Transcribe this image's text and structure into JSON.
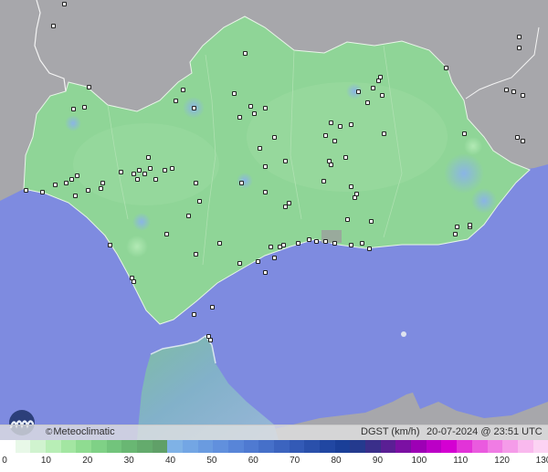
{
  "map": {
    "brand_symbol": "©",
    "brand_name": "Meteoclimatic",
    "parameter_label": "DGST (km/h)",
    "timestamp": "20-07-2024 @ 23:51 UTC",
    "colors": {
      "sea": "#7e8be0",
      "land_neighbor": "#a6a6aa",
      "region_fill": "#8fd597",
      "region_fill_light": "#9ddba1",
      "gust_spot": "#8fb6e8",
      "morocco_fill": "#86b6cc",
      "border_line": "#f2f2f2",
      "station_dot": "#222222"
    },
    "icons": {
      "logo": "meteoclimatic-logo-icon",
      "station": "weather-station-icon"
    }
  },
  "scale": {
    "unit": "km/h",
    "ticks": [
      "0",
      "10",
      "20",
      "30",
      "40",
      "50",
      "60",
      "70",
      "80",
      "90",
      "100",
      "110",
      "120",
      "130"
    ],
    "colors": [
      "#ffffff",
      "#e8f8e8",
      "#d0f3cf",
      "#b8eeb6",
      "#a3e6a2",
      "#8fdc91",
      "#7fd186",
      "#72c47c",
      "#69b773",
      "#64ab6d",
      "#60a068",
      "#7fb2e6",
      "#73a6e4",
      "#6a9be0",
      "#6190dd",
      "#5885d8",
      "#4f7ad1",
      "#4670c9",
      "#3c64bf",
      "#335ab6",
      "#2a50ab",
      "#2147a2",
      "#1a3f98",
      "#243a8e",
      "#3a2f8a",
      "#5a1f94",
      "#7b10a3",
      "#9d00b5",
      "#bb00c6",
      "#d400d2",
      "#e233d8",
      "#ea5adf",
      "#f07ce4",
      "#f59be9",
      "#f9b9ee",
      "#fcd3f3"
    ]
  }
}
